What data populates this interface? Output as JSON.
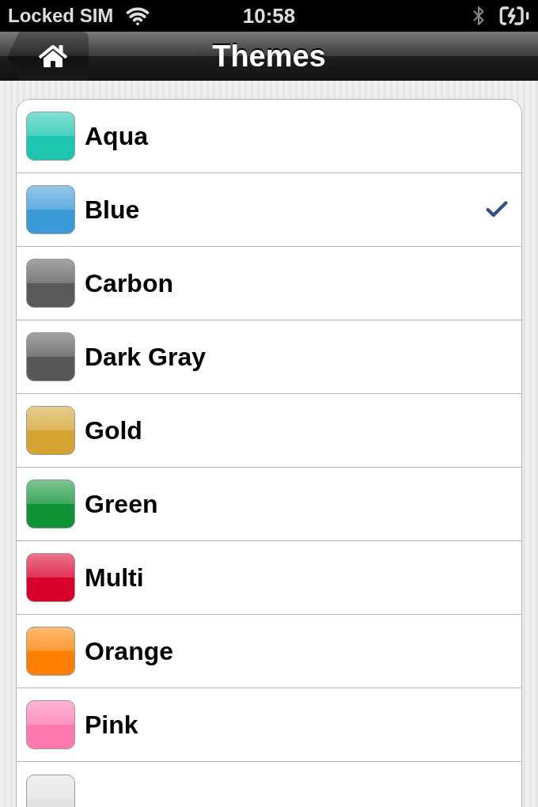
{
  "status_bar": {
    "carrier": "Locked SIM",
    "time": "10:58"
  },
  "nav_bar": {
    "title": "Themes"
  },
  "themes": [
    {
      "label": "Aqua",
      "color": "#1cc6b0",
      "selected": false
    },
    {
      "label": "Blue",
      "color": "#3a9ad8",
      "selected": true
    },
    {
      "label": "Carbon",
      "color": "#5a5a5a",
      "selected": false
    },
    {
      "label": "Dark Gray",
      "color": "#575757",
      "selected": false
    },
    {
      "label": "Gold",
      "color": "#d4a432",
      "selected": false
    },
    {
      "label": "Green",
      "color": "#0e9434",
      "selected": false
    },
    {
      "label": "Multi",
      "color": "#d8002a",
      "selected": false
    },
    {
      "label": "Orange",
      "color": "#ff8000",
      "selected": false
    },
    {
      "label": "Pink",
      "color": "#ff78b0",
      "selected": false
    },
    {
      "color": "#e2e2e2",
      "selected": false
    }
  ]
}
